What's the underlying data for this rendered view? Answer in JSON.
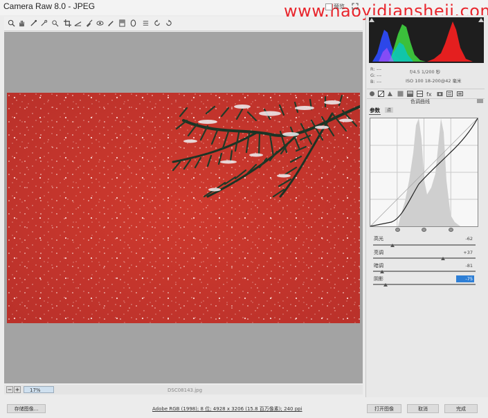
{
  "window": {
    "title": "Camera Raw 8.0 -  JPEG",
    "watermark": "www.haoyidiansheji.com"
  },
  "toolbar": {
    "tools": [
      "zoom-icon",
      "hand-icon",
      "white-balance-icon",
      "color-sampler-icon",
      "targeted-adjust-icon",
      "crop-icon",
      "straighten-icon",
      "spot-removal-icon",
      "red-eye-icon",
      "adjustment-brush-icon",
      "graduated-filter-icon",
      "radial-filter-icon",
      "preferences-icon",
      "rotate-ccw-icon",
      "rotate-cw-icon"
    ],
    "preview_label": "预览"
  },
  "status": {
    "zoom": "17%",
    "filename": "DSC08143.jpg",
    "workflow": "Adobe RGB (1998); 8 位; 4928 x 3206 (15.8 百万像素); 240 ppi"
  },
  "buttons": {
    "save": "存储图像...",
    "open": "打开图像",
    "cancel": "取消",
    "done": "完成"
  },
  "info": {
    "r": "R:",
    "g": "G:",
    "b": "B:",
    "dash": "---",
    "aperture_shutter": "f/4.5   1/200 秒",
    "iso_lens": "ISO 100   18-200@42 毫米"
  },
  "panel": {
    "title": "色调曲线",
    "tab_parametric": "参数",
    "tab_point": "点"
  },
  "sliders": [
    {
      "label": "高光",
      "value": "-62",
      "pos": 0.19
    },
    {
      "label": "亮调",
      "value": "+37",
      "pos": 0.68
    },
    {
      "label": "暗调",
      "value": "-81",
      "pos": 0.09
    },
    {
      "label": "阴影",
      "value": "-75",
      "pos": 0.12,
      "selected": true
    }
  ],
  "colors": {
    "photo_red": "#c6372c",
    "accent_blue": "#2e7fd6"
  }
}
